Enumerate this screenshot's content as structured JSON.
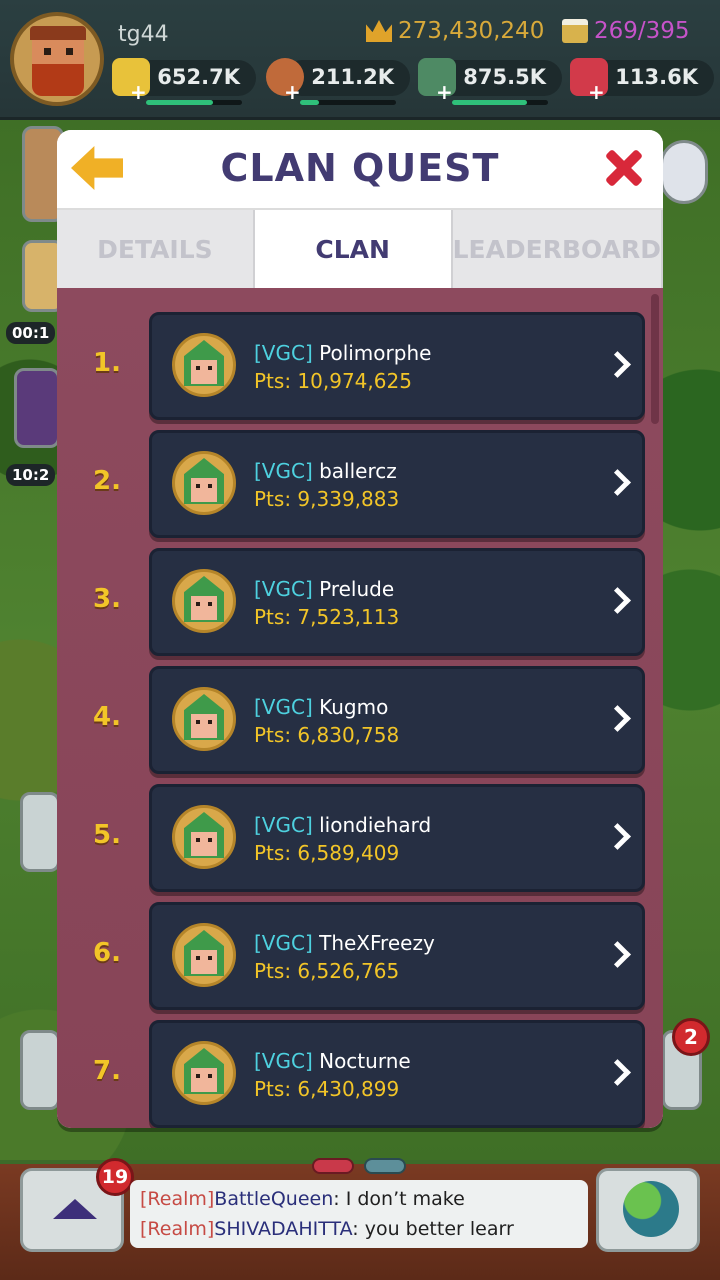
{
  "player": {
    "name": "tg44",
    "crowns": "273,430,240",
    "beer": "269/395"
  },
  "resources": [
    {
      "name": "gold",
      "value": "652.7K",
      "color": "#e8c23a",
      "fill": 0.7
    },
    {
      "name": "food",
      "value": "211.2K",
      "color": "#c06a3a",
      "fill": 0.2
    },
    {
      "name": "stone",
      "value": "875.5K",
      "color": "#4e8a64",
      "fill": 0.78
    },
    {
      "name": "ruby",
      "value": "113.6K",
      "color": "#d23a4a",
      "fill": 0.0
    }
  ],
  "side": {
    "timer1": "00:1",
    "timer2": "10:2"
  },
  "modal": {
    "title": "CLAN QUEST",
    "tabs": [
      {
        "label": "DETAILS",
        "active": false
      },
      {
        "label": "CLAN",
        "active": true
      },
      {
        "label": "LEADERBOARD",
        "active": false
      }
    ]
  },
  "members": [
    {
      "rank": "1.",
      "tag": "[VGC]",
      "name": "Polimorphe",
      "pts": "Pts: 10,974,625"
    },
    {
      "rank": "2.",
      "tag": "[VGC]",
      "name": "ballercz",
      "pts": "Pts: 9,339,883"
    },
    {
      "rank": "3.",
      "tag": "[VGC]",
      "name": "Prelude",
      "pts": "Pts: 7,523,113"
    },
    {
      "rank": "4.",
      "tag": "[VGC]",
      "name": "Kugmo",
      "pts": "Pts: 6,830,758"
    },
    {
      "rank": "5.",
      "tag": "[VGC]",
      "name": "liondiehard",
      "pts": "Pts: 6,589,409"
    },
    {
      "rank": "6.",
      "tag": "[VGC]",
      "name": "TheXFreezy",
      "pts": "Pts: 6,526,765"
    },
    {
      "rank": "7.",
      "tag": "[VGC]",
      "name": "Nocturne",
      "pts": "Pts: 6,430,899"
    }
  ],
  "chat": {
    "badge": "19",
    "lines": [
      {
        "realm": "[Realm]",
        "who": "BattleQueen",
        "text": ": I don’t make"
      },
      {
        "realm": "[Realm]",
        "who": "SHIVADAHITTA",
        "text": ": you better learr"
      }
    ]
  },
  "notification_badge": "2"
}
